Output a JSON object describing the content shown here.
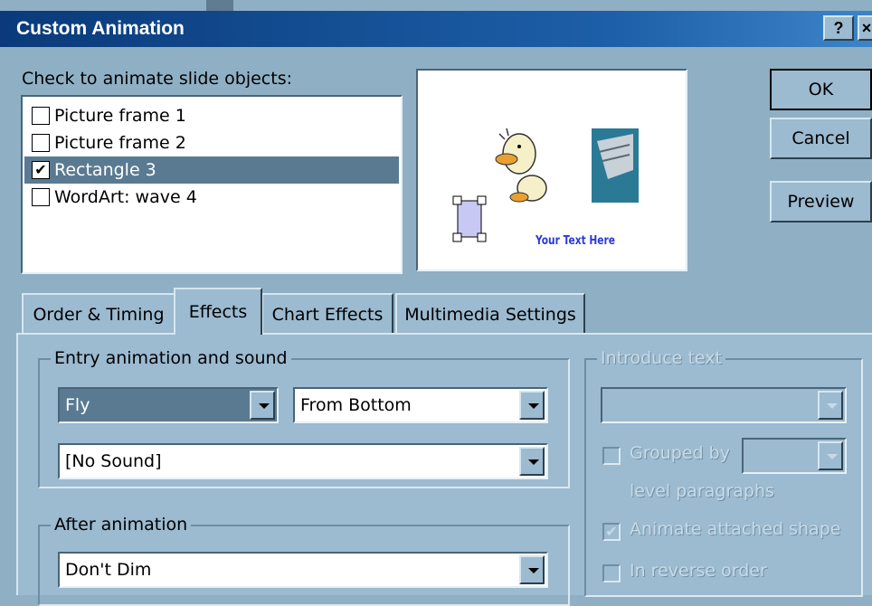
{
  "dialog": {
    "title": "Custom Animation",
    "help_btn": "?",
    "close_btn": "×",
    "ok": "OK",
    "cancel": "Cancel",
    "preview": "Preview"
  },
  "objects": {
    "label": "Check to animate slide objects:",
    "items": [
      {
        "label": "Picture frame 1",
        "checked": false,
        "mark": ""
      },
      {
        "label": "Picture frame 2",
        "checked": false,
        "mark": ""
      },
      {
        "label": "Rectangle 3",
        "checked": true,
        "mark": "✔"
      },
      {
        "label": "WordArt: wave 4",
        "checked": false,
        "mark": ""
      }
    ]
  },
  "preview_slide": {
    "wordart_text": "Your Text Here"
  },
  "tabs": [
    {
      "label": "Order & Timing",
      "active": false
    },
    {
      "label": "Effects",
      "active": true
    },
    {
      "label": "Chart Effects",
      "active": false
    },
    {
      "label": "Multimedia Settings",
      "active": false
    }
  ],
  "entry": {
    "group_label": "Entry animation and sound",
    "effect": "Fly",
    "direction": "From Bottom",
    "sound": "[No Sound]"
  },
  "after": {
    "group_label": "After animation",
    "value": "Don't Dim"
  },
  "introduce": {
    "group_label": "Introduce text",
    "value": "",
    "grouped_by_label": "Grouped by",
    "grouped_by_value": "",
    "level_label": "level paragraphs",
    "attached_label": "Animate attached shape",
    "attached_mark": "✔",
    "reverse_label": "In reverse order"
  },
  "colors": {
    "dialog_bg": "#9cbad0",
    "selection": "#5a7a92",
    "title_gradient_start": "#0a3a7a"
  }
}
